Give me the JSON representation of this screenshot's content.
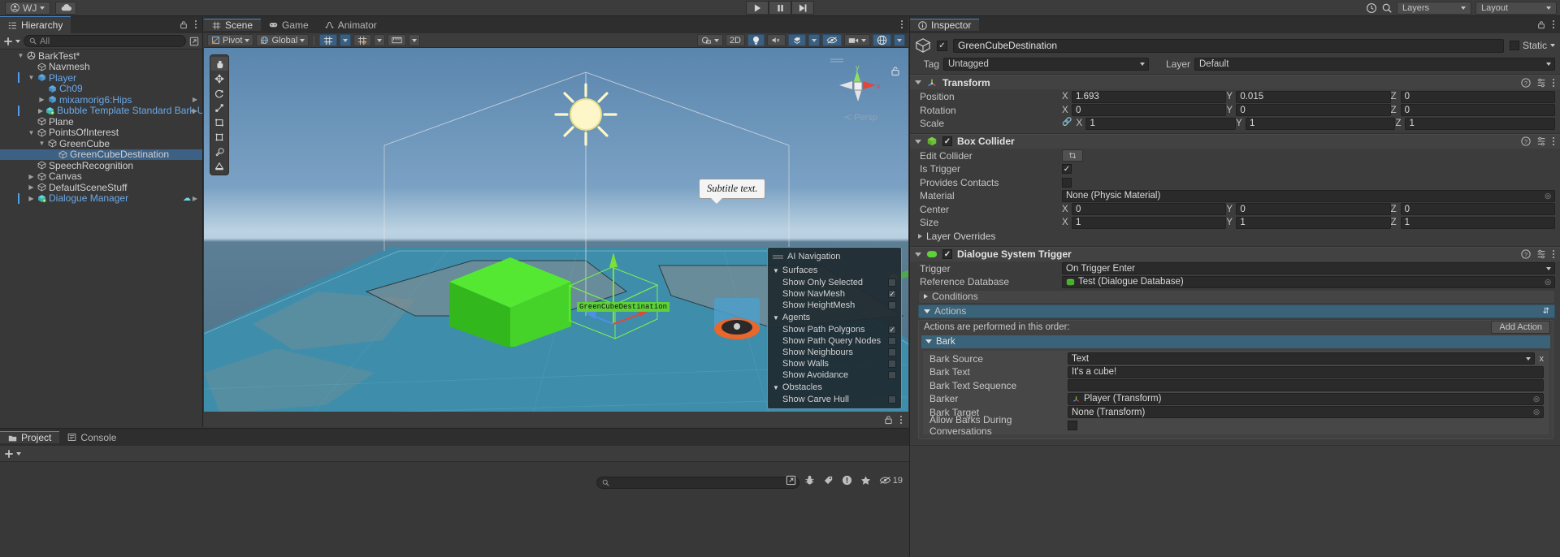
{
  "topbar": {
    "account": "WJ",
    "cloud_icon": "cloud-icon",
    "play_icon": "play-icon",
    "pause_icon": "pause-icon",
    "step_icon": "step-icon",
    "history_icon": "history-icon",
    "search_icon": "search-icon",
    "layers_label": "Layers",
    "layout_label": "Layout"
  },
  "hierarchy": {
    "tab": "Hierarchy",
    "tab_icon": "hierarchy-icon",
    "add_label": "+",
    "search_placeholder": "All",
    "items": [
      {
        "label": "BarkTest*",
        "depth": 1,
        "arrow": "down",
        "icon": "scene-icon",
        "type": "scene",
        "selected": false,
        "marker": false
      },
      {
        "label": "Navmesh",
        "depth": 2,
        "arrow": "none",
        "icon": "cube-icon",
        "type": "go",
        "selected": false,
        "marker": false
      },
      {
        "label": "Player",
        "depth": 2,
        "arrow": "down",
        "icon": "prefab-icon",
        "type": "prefab",
        "selected": false,
        "marker": true
      },
      {
        "label": "Ch09",
        "depth": 3,
        "arrow": "none",
        "icon": "cube-icon",
        "type": "prefab",
        "selected": false,
        "marker": false
      },
      {
        "label": "mixamorig6:Hips",
        "depth": 3,
        "arrow": "right",
        "icon": "cube-icon",
        "type": "prefab",
        "selected": false,
        "marker": false
      },
      {
        "label": "Bubble Template Standard Bark UI",
        "depth": 3,
        "arrow": "right",
        "icon": "prefab-variant-icon",
        "type": "prefab",
        "selected": false,
        "marker": true
      },
      {
        "label": "Plane",
        "depth": 2,
        "arrow": "none",
        "icon": "cube-icon",
        "type": "go",
        "selected": false,
        "marker": false
      },
      {
        "label": "PointsOfInterest",
        "depth": 2,
        "arrow": "down",
        "icon": "cube-icon",
        "type": "go",
        "selected": false,
        "marker": false
      },
      {
        "label": "GreenCube",
        "depth": 3,
        "arrow": "down",
        "icon": "cube-icon",
        "type": "go",
        "selected": false,
        "marker": false
      },
      {
        "label": "GreenCubeDestination",
        "depth": 4,
        "arrow": "none",
        "icon": "cube-icon",
        "type": "go",
        "selected": true,
        "marker": false
      },
      {
        "label": "SpeechRecognition",
        "depth": 2,
        "arrow": "none",
        "icon": "cube-icon",
        "type": "go",
        "selected": false,
        "marker": false
      },
      {
        "label": "Canvas",
        "depth": 2,
        "arrow": "right",
        "icon": "cube-icon",
        "type": "go",
        "selected": false,
        "marker": false
      },
      {
        "label": "DefaultSceneStuff",
        "depth": 2,
        "arrow": "right",
        "icon": "cube-icon",
        "type": "go",
        "selected": false,
        "marker": false
      },
      {
        "label": "Dialogue Manager",
        "depth": 2,
        "arrow": "right",
        "icon": "prefab-variant-icon",
        "type": "prefab",
        "selected": false,
        "marker": true
      }
    ]
  },
  "scene": {
    "tabs": [
      {
        "label": "Scene",
        "icon": "scene-grid-icon",
        "active": true
      },
      {
        "label": "Game",
        "icon": "gamepad-icon",
        "active": false
      },
      {
        "label": "Animator",
        "icon": "animator-icon",
        "active": false
      }
    ],
    "toolbar": {
      "pivot": "Pivot",
      "global": "Global",
      "grid_icon": "grid-snap-icon",
      "snap_icon": "snap-increment-icon",
      "ruler_icon": "ruler-icon",
      "shading_icon": "shading-mode-icon",
      "twod_label": "2D",
      "light_icon": "lighting-icon",
      "audio_icon": "audio-mute-icon",
      "fx_icon": "effects-icon",
      "hidden_icon": "hidden-objects-icon",
      "camera_icon": "scene-camera-icon",
      "gizmos_icon": "gizmos-icon"
    },
    "tools": [
      "hand-tool",
      "move-tool",
      "rotate-tool",
      "scale-tool",
      "rect-tool",
      "transform-tool",
      "custom-tool",
      "collider-tool"
    ],
    "gizmo": {
      "y_label": "y",
      "x_label": "x",
      "persp_label": "Persp"
    },
    "bubble_text": "Subtitle text.",
    "cube_label": "GreenCubeDestination",
    "ai_nav": {
      "title": "AI Navigation",
      "groups": [
        {
          "name": "Surfaces",
          "items": [
            {
              "label": "Show Only Selected",
              "checked": false
            },
            {
              "label": "Show NavMesh",
              "checked": true
            },
            {
              "label": "Show HeightMesh",
              "checked": false
            }
          ]
        },
        {
          "name": "Agents",
          "items": [
            {
              "label": "Show Path Polygons",
              "checked": true
            },
            {
              "label": "Show Path Query Nodes",
              "checked": false
            },
            {
              "label": "Show Neighbours",
              "checked": false
            },
            {
              "label": "Show Walls",
              "checked": false
            },
            {
              "label": "Show Avoidance",
              "checked": false
            }
          ]
        },
        {
          "name": "Obstacles",
          "items": [
            {
              "label": "Show Carve Hull",
              "checked": false
            }
          ]
        }
      ]
    }
  },
  "inspector": {
    "tab": "Inspector",
    "tab_icon": "info-icon",
    "object_name": "GreenCubeDestination",
    "enabled": true,
    "static_label": "Static",
    "tag_label": "Tag",
    "tag_value": "Untagged",
    "layer_label": "Layer",
    "layer_value": "Default",
    "components": [
      {
        "name": "Transform",
        "icon": "transform-icon",
        "rows": [
          {
            "label": "Position",
            "x": "1.693",
            "y": "0.015",
            "z": "0"
          },
          {
            "label": "Rotation",
            "x": "0",
            "y": "0",
            "z": "0"
          },
          {
            "label": "Scale",
            "x": "1",
            "y": "1",
            "z": "1",
            "link_icon": "constrain-proportions-icon"
          }
        ]
      },
      {
        "name": "Box Collider",
        "icon": "box-collider-icon",
        "enabled": true,
        "edit_collider_label": "Edit Collider",
        "edit_collider_icon": "edit-collider-icon",
        "is_trigger_label": "Is Trigger",
        "is_trigger": true,
        "provides_contacts_label": "Provides Contacts",
        "provides_contacts": false,
        "material_label": "Material",
        "material_value": "None (Physic Material)",
        "center_label": "Center",
        "center": {
          "x": "0",
          "y": "0",
          "z": "0"
        },
        "size_label": "Size",
        "size": {
          "x": "1",
          "y": "1",
          "z": "1"
        },
        "layer_overrides_label": "Layer Overrides"
      },
      {
        "name": "Dialogue System Trigger",
        "icon": "script-icon",
        "enabled": true,
        "trigger_label": "Trigger",
        "trigger_value": "On Trigger Enter",
        "reference_db_label": "Reference Database",
        "reference_db_value": "Test (Dialogue Database)",
        "reference_db_icon": "database-icon",
        "conditions_label": "Conditions",
        "actions_label": "Actions",
        "actions_note": "Actions are performed in this order:",
        "add_action_label": "Add Action",
        "bark_label": "Bark",
        "bark_remove_label": "x",
        "bark_fields": [
          {
            "label": "Bark Source",
            "value": "Text",
            "kind": "dropdown"
          },
          {
            "label": "Bark Text",
            "value": "It's a cube!",
            "kind": "text"
          },
          {
            "label": "Bark Text Sequence",
            "value": "",
            "kind": "text"
          },
          {
            "label": "Barker",
            "value": "Player (Transform)",
            "kind": "object",
            "icon": "transform-icon"
          },
          {
            "label": "Bark Target",
            "value": "None (Transform)",
            "kind": "object",
            "icon": ""
          },
          {
            "label": "Allow Barks During Conversations",
            "value": "",
            "kind": "checkbox",
            "checked": false
          }
        ]
      }
    ]
  },
  "project": {
    "tabs": [
      {
        "label": "Project",
        "icon": "folder-icon",
        "active": true
      },
      {
        "label": "Console",
        "icon": "console-icon",
        "active": false
      }
    ],
    "add_label": "+",
    "search_placeholder": "",
    "search_icon": "search-icon"
  },
  "statusbar": {
    "lock_icon": "lock-icon",
    "menu_icon": "kebab-menu-icon",
    "icons": [
      "open-external-icon",
      "bug-icon",
      "tag-icon",
      "error-icon",
      "star-icon",
      "eye-off-icon"
    ],
    "count": "19"
  },
  "colors": {
    "accent_blue": "#3d6185",
    "panel_bg": "#3c3c3c",
    "dark_bg": "#2e2e2e",
    "prefab_blue": "#6ba9e8",
    "green_cube": "#3fd41a",
    "teal": "#3a6278"
  }
}
